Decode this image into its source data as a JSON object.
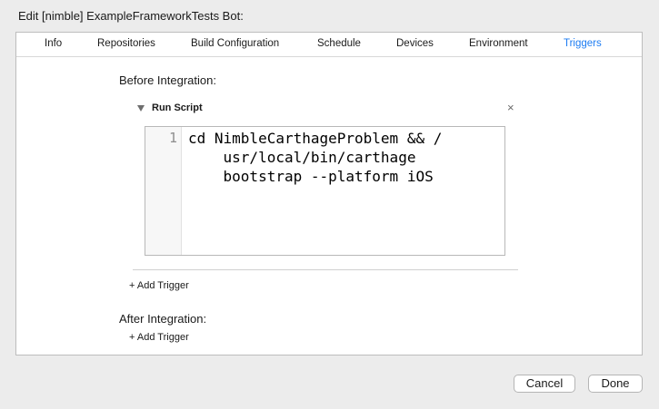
{
  "window": {
    "title": "Edit [nimble] ExampleFrameworkTests Bot:"
  },
  "tabs": [
    {
      "label": "Info"
    },
    {
      "label": "Repositories"
    },
    {
      "label": "Build Configuration"
    },
    {
      "label": "Schedule"
    },
    {
      "label": "Devices"
    },
    {
      "label": "Environment"
    },
    {
      "label": "Triggers",
      "active": true
    }
  ],
  "before": {
    "label": "Before Integration:",
    "script": {
      "title": "Run Script",
      "close_glyph": "×",
      "line_number": "1",
      "code": "cd NimbleCarthageProblem && /\n    usr/local/bin/carthage\n    bootstrap --platform iOS"
    },
    "add_trigger": "+ Add Trigger"
  },
  "after": {
    "label": "After Integration:",
    "add_trigger": "+ Add Trigger"
  },
  "footer": {
    "cancel_label": "Cancel",
    "done_label": "Done"
  },
  "colors": {
    "accent": "#1d7cf2"
  },
  "icons": {
    "disclosure": "disclosure-triangle-icon",
    "close": "close-icon"
  }
}
